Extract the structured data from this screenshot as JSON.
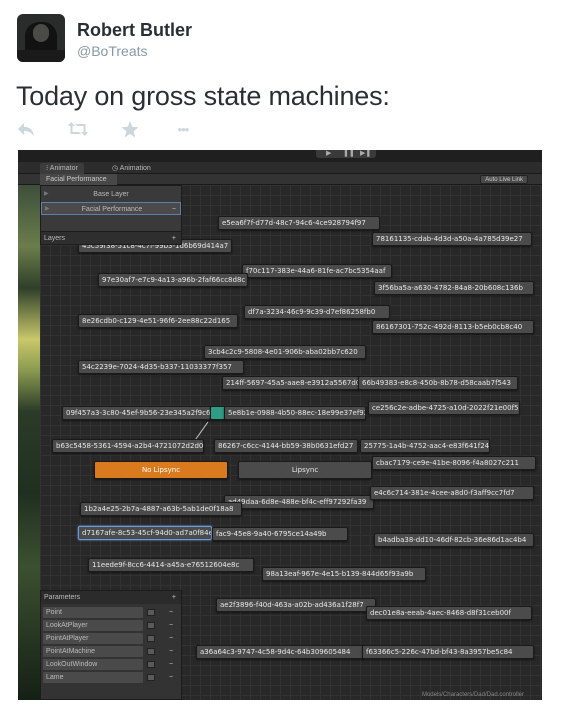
{
  "tweet": {
    "name": "Robert Butler",
    "handle": "@BoTreats",
    "text": "Today on gross state machines:"
  },
  "actions": [
    {
      "icon": "reply-icon"
    },
    {
      "icon": "retweet-icon"
    },
    {
      "icon": "favorite-star-icon"
    },
    {
      "icon": "more-icon",
      "label": "•••"
    }
  ],
  "unity": {
    "tabs": [
      "Animator",
      "Animation"
    ],
    "breadcrumb": "Facial Performance",
    "auto_live_link": "Auto Live Link",
    "layers": {
      "items": [
        "Base Layer",
        "Facial Performance"
      ],
      "header": "Layers",
      "add": "+",
      "remove": "−"
    },
    "parameters": {
      "header": "Parameters",
      "add": "+",
      "remove": "−",
      "items": [
        "Point",
        "LookAtPlayer",
        "PointAtPlayer",
        "PointAtMachine",
        "LookOutWindow",
        "Lame"
      ]
    },
    "nodes": {
      "n1": "e5ea6f7f-d77d-48c7-94c6-4ce928794f97",
      "n2": "78161135-cdab-4d3d-a50a-4a785d39e27",
      "n3": "45c59f38-51c8-4c7f-99b3-1d6b69d414a7",
      "n4": "f70c117-383e-44a6-81fe-ac7bc5354aaf",
      "n5": "97e30af7-e7c9-4a13-a96b-2faf66cc8d8c",
      "n6": "3f56ba5a-a630-4782-84a8-20b608c136b",
      "n7": "df7a-3234-46c9-9c39-d7ef86258fb0",
      "n8": "8e26cdb0-c129-4e51-96f6-2ee88c22d165",
      "n9": "86167301-752c-492d-8113-b5eb0cb8c40",
      "n10": "3cb4c2c9-5808-4e01-906b-aba02bb7c620",
      "n11": "54c2239e-7024-4d35-b337-11033377f357",
      "n12": "214ff-5697-45a5-aae8-e3912a5567d0",
      "n13": "66b49383-e8c8-450b-8b78-d58caab7f543",
      "n14": "09f457a3-3c80-45ef-9b56-23e345a2f9c6",
      "n15": "5e8b1e-0988-4b50-88ec-18e99e37ef92",
      "n16": "ce256c2e-adbe-4725-a10d-2022f21e00f5",
      "n17": "b63c5458-5361-4594-a2b4-4721072d2d0",
      "n18": "86267-c6cc-4144-bb59-38b0631efd27",
      "n19": "25775-1a4b-4752-aac4-e83f641f2481",
      "n20": "No Lipsync",
      "n21": "Lipsync",
      "n22": "cbac7179-ce9e-41be-8096-f4a8027c211",
      "n23": "ad49daa-6d8e-488e-bf4c-eff97292fa39",
      "n24": "e4c6c714-381e-4cee-a8d0-f3aff9cc7fd7",
      "n25": "1b2a4e25-2b7a-4887-a63b-5ab1de0f18a8",
      "n26": "d7167afe-8c53-45cf-94d0-ad7a0f84e4f9",
      "n27": "fac9-45e8-9a40-6795ce14a49b",
      "n28": "b4adba38-dd10-46df-82cb-36e86d1ac4b4",
      "n29": "11eede9f-8cc6-4414-a45a-e76512604e8c",
      "n30": "98a13eaf-967e-4e15-b139-844d65f93a9b",
      "n31": "ae2f3896-f40d-463a-a02b-ad436a1f28f7",
      "n32": "dec01e8a-eeab-4aec-8468-d8f31ceb00f",
      "n33": "a36a64c3-9747-4c58-9d4c-64b309605484",
      "n34": "f63366c5-226c-47bd-bf43-8a3957be5c84"
    },
    "status": "Models/Characters/Dad/Dad.controller",
    "colors": {
      "orange_state": "#d97a1e",
      "teal_state": "#2f9c84",
      "selection": "#6a9be0"
    }
  }
}
